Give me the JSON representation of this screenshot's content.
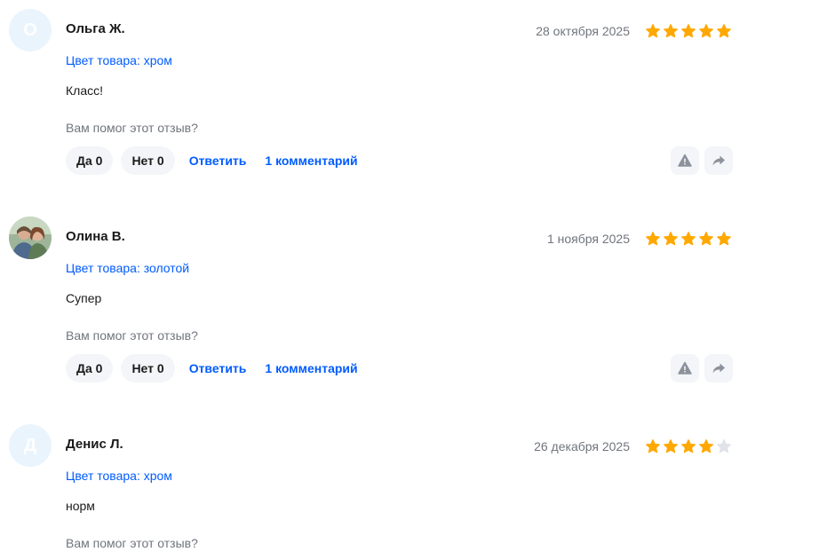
{
  "reviews": [
    {
      "avatar_letter": "О",
      "avatar_color": "#eaf4fd",
      "author": "Ольга Ж.",
      "date": "28 октября 2025",
      "rating": 5,
      "variant": "Цвет товара: хром",
      "text": "Класс!",
      "helpful_question": "Вам помог этот отзыв?",
      "yes_label": "Да 0",
      "no_label": "Нет 0",
      "reply_label": "Ответить",
      "comments_label": "1 комментарий"
    },
    {
      "avatar_letter": "",
      "avatar_color": "#c8d6c0",
      "author": "Олина В.",
      "date": "1 ноября 2025",
      "rating": 5,
      "variant": "Цвет товара: золотой",
      "text": "Супер",
      "helpful_question": "Вам помог этот отзыв?",
      "yes_label": "Да 0",
      "no_label": "Нет 0",
      "reply_label": "Ответить",
      "comments_label": "1 комментарий"
    },
    {
      "avatar_letter": "Д",
      "avatar_color": "#eaf4fd",
      "author": "Денис Л.",
      "date": "26 декабря 2025",
      "rating": 4,
      "variant": "Цвет товара: хром",
      "text": "норм",
      "helpful_question": "Вам помог этот отзыв?"
    }
  ],
  "icons": {
    "star_filled": "star-filled-icon",
    "star_empty": "star-empty-icon",
    "report": "warning-triangle-icon",
    "share": "share-arrow-icon"
  },
  "colors": {
    "accent": "#005bff",
    "star": "#ffa800",
    "star_empty": "#e0e3e8",
    "muted_text": "#70757d",
    "pill_bg": "#f4f5f8"
  }
}
